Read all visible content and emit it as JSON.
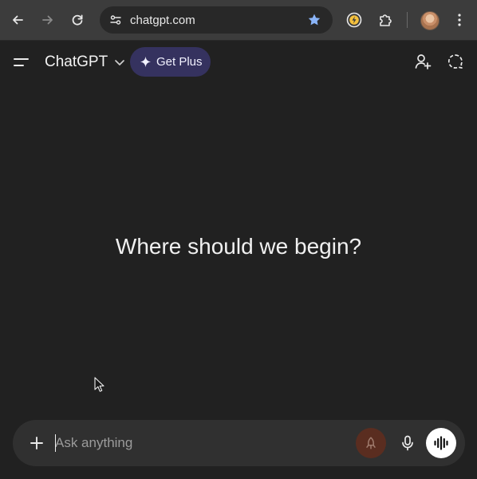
{
  "browser": {
    "url": "chatgpt.com",
    "back_icon": "arrow-left-icon",
    "forward_icon": "arrow-right-icon",
    "reload_icon": "reload-icon",
    "bookmarked": true,
    "accent_color": "#8ab4f8"
  },
  "header": {
    "model_name": "ChatGPT",
    "upgrade_label": "Get Plus",
    "upgrade_color": "#35325f"
  },
  "main": {
    "greeting": "Where should we begin?"
  },
  "composer": {
    "placeholder": "Ask anything",
    "value": ""
  }
}
